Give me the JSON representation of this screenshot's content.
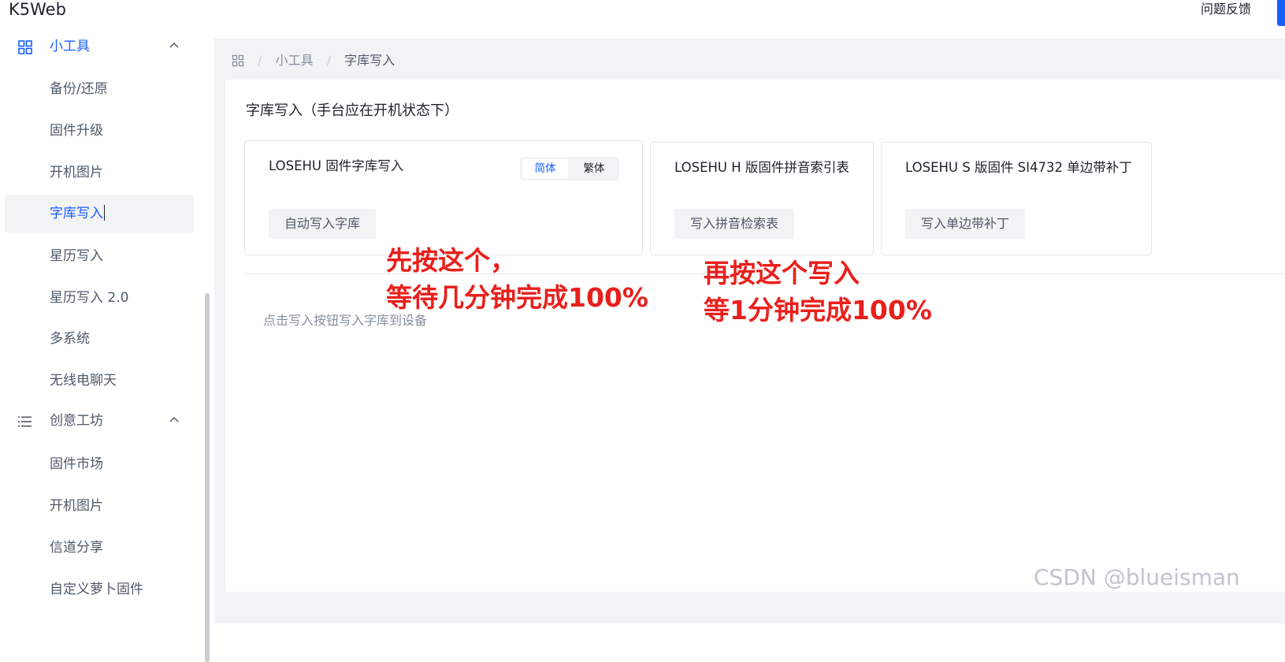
{
  "header": {
    "app_title": "K5Web",
    "feedback_label": "问题反馈"
  },
  "sidebar": {
    "groups": [
      {
        "label": "小工具",
        "icon": "apps-grid-icon",
        "expanded": true,
        "items": [
          {
            "label": "备份/还原"
          },
          {
            "label": "固件升级"
          },
          {
            "label": "开机图片"
          },
          {
            "label": "字库写入",
            "active": true
          },
          {
            "label": "星历写入"
          },
          {
            "label": "星历写入 2.0"
          },
          {
            "label": "多系统"
          },
          {
            "label": "无线电聊天"
          }
        ]
      },
      {
        "label": "创意工坊",
        "icon": "list-icon",
        "expanded": true,
        "items": [
          {
            "label": "固件市场"
          },
          {
            "label": "开机图片"
          },
          {
            "label": "信道分享"
          },
          {
            "label": "自定义萝卜固件"
          }
        ]
      }
    ]
  },
  "breadcrumb": {
    "home_icon": "apps-grid-icon",
    "items": [
      "小工具",
      "字库写入"
    ]
  },
  "main": {
    "section_title": "字库写入（手台应在开机状态下）",
    "cards": [
      {
        "title": "LOSEHU 固件字库写入",
        "segment": {
          "options": [
            "简体",
            "繁体"
          ],
          "selected": "简体"
        },
        "button_label": "自动写入字库"
      },
      {
        "title": "LOSEHU H 版固件拼音索引表",
        "button_label": "写入拼音检索表"
      },
      {
        "title": "LOSEHU S 版固件 SI4732 单边带补丁",
        "button_label": "写入单边带补丁"
      }
    ],
    "hint_text": "点击写入按钮写入字库到设备"
  },
  "annotations": {
    "first": [
      "先按这个，",
      "等待几分钟完成100%"
    ],
    "second": [
      "再按这个写入",
      "等1分钟完成100%"
    ],
    "color": "#e8201c"
  },
  "watermark": "CSDN @blueisman",
  "colors": {
    "primary": "#165dff",
    "active_bg": "#f2f3f5",
    "content_bg": "#f2f3f5"
  }
}
